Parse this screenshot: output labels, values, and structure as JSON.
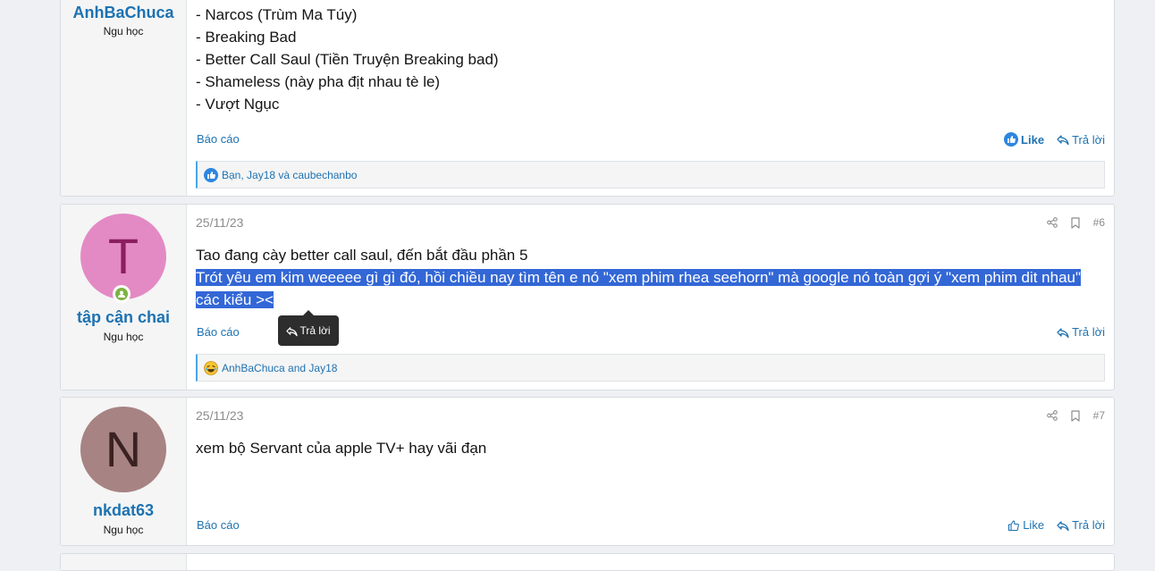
{
  "posts": [
    {
      "username": "AnhBaChuca",
      "usertitle": "Ngu học",
      "content_lines": [
        "- Narcos (Trùm Ma Túy)",
        "- Breaking Bad",
        "- Better Call Saul (Tiền Truyện Breaking bad)",
        "- Shameless (này pha địt nhau tè le)",
        "- Vượt Ngục"
      ],
      "report_label": "Báo cáo",
      "like_label": "Like",
      "reply_label": "Trả lời",
      "reactions_text": "Bạn, Jay18 và caubechanbo"
    },
    {
      "avatar_letter": "T",
      "avatar_bg": "#e38ac4",
      "avatar_fg": "#8b1f5e",
      "username": "tập cận chai",
      "usertitle": "Ngu học",
      "date": "25/11/23",
      "post_number": "#6",
      "content_line1": "Tao đang cày better call saul, đến bắt đầu phần 5",
      "content_selected": "Trót yêu em kim weeeee gì gì đó, hồi chiều nay tìm tên e nó \"xem phim rhea seehorn\" mà google nó toàn gợi ý \"xem phim dit nhau\" các kiểu ><",
      "report_label": "Báo cáo",
      "reply_label": "Trả lời",
      "reactions_text": "AnhBaChuca and Jay18",
      "tooltip_label": "Trả lời"
    },
    {
      "avatar_letter": "N",
      "avatar_bg": "#a88383",
      "avatar_fg": "#3b2222",
      "username": "nkdat63",
      "usertitle": "Ngu học",
      "date": "25/11/23",
      "post_number": "#7",
      "content": "xem bộ Servant của apple TV+ hay vãi đạn",
      "report_label": "Báo cáo",
      "like_label": "Like",
      "reply_label": "Trả lời"
    }
  ],
  "colors": {
    "link": "#1d72b1",
    "selection": "#3367d6",
    "online": "#7cb342"
  }
}
